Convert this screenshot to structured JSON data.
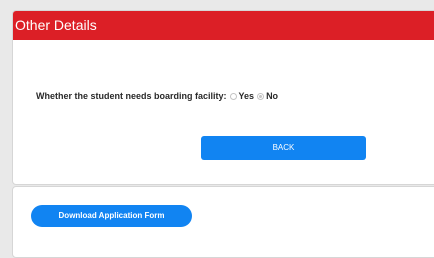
{
  "section": {
    "title": "Other Details"
  },
  "boarding": {
    "question": "Whether the student needs boarding facility:",
    "options": [
      {
        "label": "Yes",
        "selected": false
      },
      {
        "label": "No",
        "selected": true
      }
    ]
  },
  "actions": {
    "back_label": "BACK",
    "download_label": "Download Application Form"
  },
  "colors": {
    "header": "#dc1f26",
    "primary_button": "#1184f2"
  }
}
